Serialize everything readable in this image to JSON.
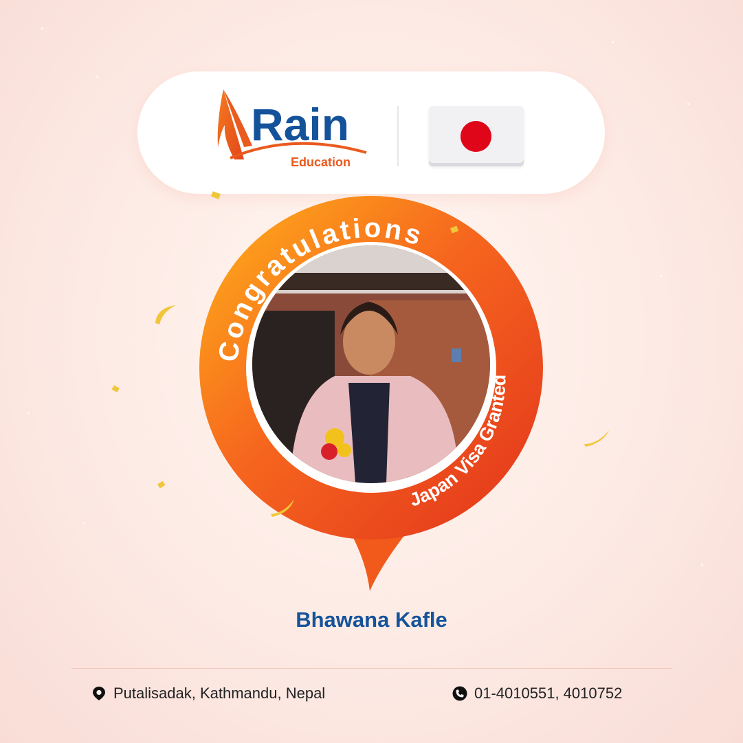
{
  "brand": {
    "name": "Rain",
    "tagline": "Education",
    "primary_color": "#14539a",
    "accent_color": "#ea5a1e"
  },
  "flag": {
    "country_icon": "japan-flag-icon"
  },
  "badge": {
    "headline": "Congratulations",
    "subline": "Japan Visa Granted"
  },
  "student": {
    "name": "Bhawana Kafle"
  },
  "footer": {
    "address": "Putalisadak, Kathmandu, Nepal",
    "phone": "01-4010551, 4010752",
    "address_icon": "location-pin-icon",
    "phone_icon": "phone-icon"
  }
}
